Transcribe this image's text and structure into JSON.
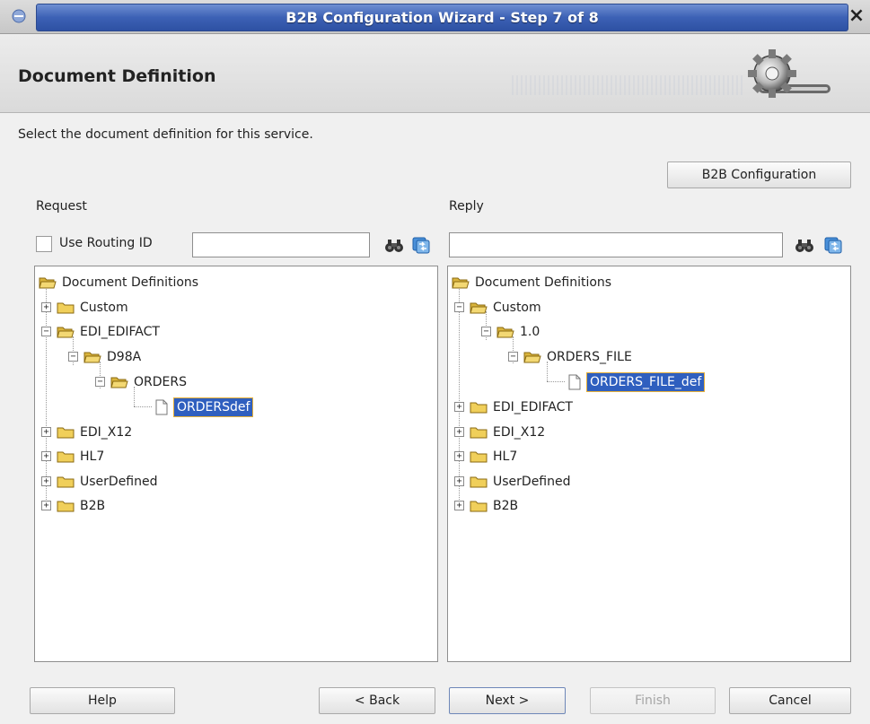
{
  "window": {
    "title": "B2B Configuration Wizard - Step 7 of 8",
    "close_symbol": "×"
  },
  "header": {
    "title": "Document Definition"
  },
  "instruction": "Select the document definition for this service.",
  "b2b_config_button": "B2B Configuration",
  "request": {
    "label": "Request",
    "use_routing_id_label": "Use Routing ID",
    "routing_id_value": "",
    "tree": {
      "root": "Document Definitions",
      "items": [
        "Custom",
        "EDI_EDIFACT",
        "D98A",
        "ORDERS",
        "ORDERSdef",
        "EDI_X12",
        "HL7",
        "UserDefined",
        "B2B"
      ]
    }
  },
  "reply": {
    "label": "Reply",
    "search_value": "",
    "tree": {
      "root": "Document Definitions",
      "items": [
        "Custom",
        "1.0",
        "ORDERS_FILE",
        "ORDERS_FILE_def",
        "EDI_EDIFACT",
        "EDI_X12",
        "HL7",
        "UserDefined",
        "B2B"
      ]
    }
  },
  "footer": {
    "help": "Help",
    "back": "< Back",
    "next": "Next >",
    "finish": "Finish",
    "cancel": "Cancel"
  },
  "colors": {
    "title_bar": "#3c61b5",
    "selection": "#2f5fbf",
    "selection_border": "#e6b03a",
    "folder": "#e9c84a"
  },
  "icons": [
    "search-binoculars-icon",
    "refresh-icon",
    "folder-icon",
    "open-folder-icon",
    "document-icon",
    "gear-icon"
  ]
}
